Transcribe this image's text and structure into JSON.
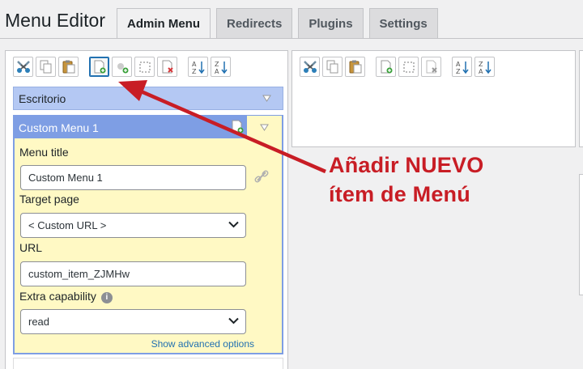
{
  "page": {
    "title": "Menu Editor"
  },
  "tabs": [
    {
      "label": "Admin Menu",
      "active": true
    },
    {
      "label": "Redirects",
      "active": false
    },
    {
      "label": "Plugins",
      "active": false
    },
    {
      "label": "Settings",
      "active": false
    }
  ],
  "toolbar_left": [
    "cut-icon",
    "copy-icon",
    "paste-icon",
    "new-menu-item-icon",
    "new-separator-icon",
    "toggle-hidden-icon",
    "delete-icon",
    "sort-ascending-icon",
    "sort-descending-icon"
  ],
  "toolbar_right": [
    "cut-icon",
    "copy-icon",
    "paste-icon",
    "new-menu-item-icon",
    "toggle-hidden-icon",
    "delete-icon",
    "sort-ascending-icon",
    "sort-descending-icon"
  ],
  "menu": {
    "item_escritorio": "Escritorio",
    "custom_item_title": "Custom Menu 1"
  },
  "editor": {
    "menu_title_label": "Menu title",
    "menu_title_value": "Custom Menu 1",
    "target_page_label": "Target page",
    "target_page_value": "< Custom URL >",
    "url_label": "URL",
    "url_value": "custom_item_ZJMHw",
    "extra_capability_label": "Extra capability",
    "extra_capability_value": "read",
    "info_glyph": "i",
    "advanced_link": "Show advanced options"
  },
  "annotation": {
    "line1": "Añadir NUEVO",
    "line2": "ítem de Menú",
    "color": "#c81d25"
  }
}
